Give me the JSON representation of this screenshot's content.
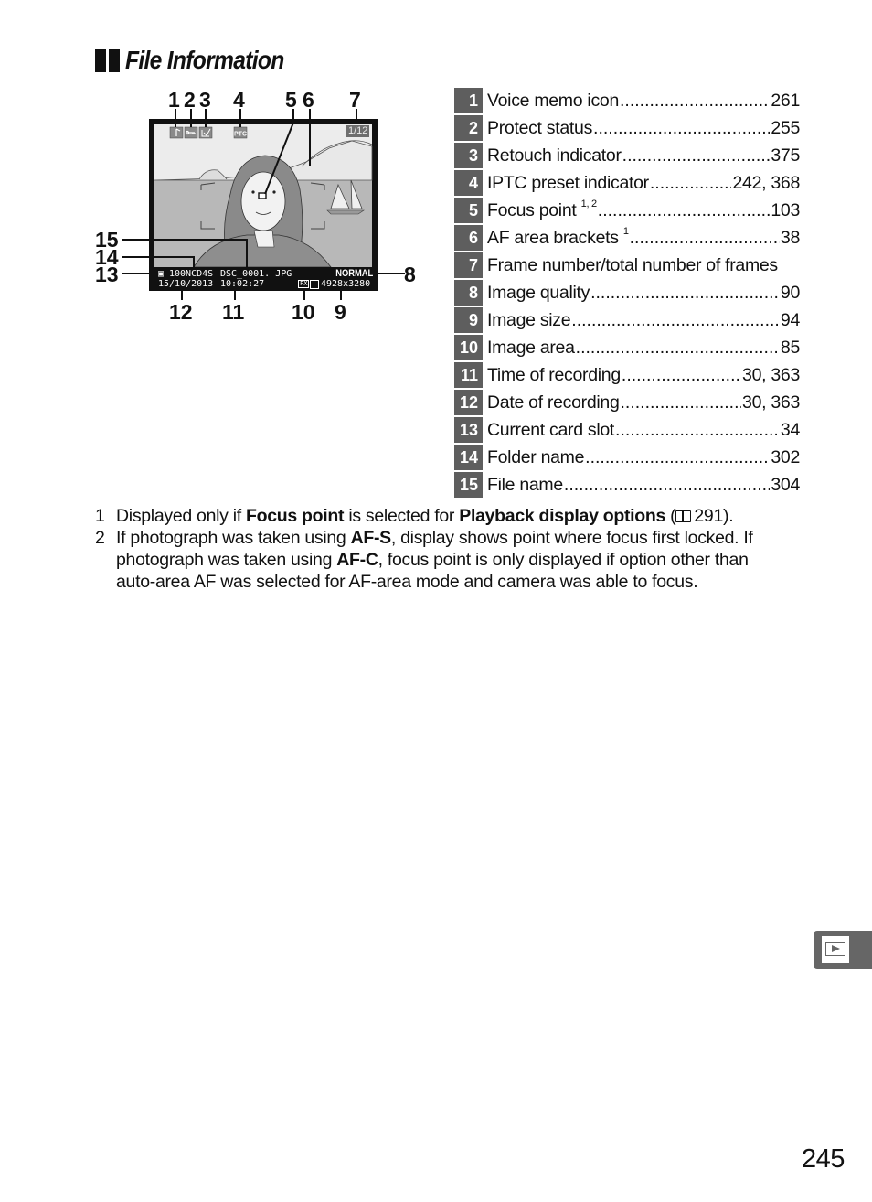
{
  "section": {
    "title": "File Information"
  },
  "illustration": {
    "callouts": [
      "1",
      "2",
      "3",
      "4",
      "5",
      "6",
      "7",
      "8",
      "9",
      "10",
      "11",
      "12",
      "13",
      "14",
      "15"
    ],
    "screen": {
      "frame_counter": "1/12",
      "iptc_label": "IPTC",
      "folder_name": "100NCD4S",
      "file_name": "DSC_0001. JPG",
      "image_quality": "NORMAL",
      "date": "15/10/2013",
      "time": "10:02:27",
      "image_area_badge": "FX",
      "image_size": "4928x3280",
      "icons": [
        "voice-memo-icon",
        "protect-key-icon",
        "retouch-icon",
        "iptc-icon",
        "card-slot-icon",
        "image-area-fx-icon",
        "image-size-large-icon"
      ]
    }
  },
  "references": [
    {
      "num": "1",
      "label": "Voice memo icon",
      "sup": "",
      "page": "261"
    },
    {
      "num": "2",
      "label": "Protect status",
      "sup": "",
      "page": "255"
    },
    {
      "num": "3",
      "label": "Retouch indicator",
      "sup": "",
      "page": "375"
    },
    {
      "num": "4",
      "label": "IPTC preset indicator",
      "sup": "",
      "page": "242, 368"
    },
    {
      "num": "5",
      "label": "Focus point",
      "sup": "1, 2",
      "page": "103"
    },
    {
      "num": "6",
      "label": "AF area brackets",
      "sup": "1",
      "page": "38"
    },
    {
      "num": "7",
      "label": "Frame number/total number of frames",
      "sup": "",
      "page": ""
    },
    {
      "num": "8",
      "label": "Image quality",
      "sup": "",
      "page": "90"
    },
    {
      "num": "9",
      "label": "Image size",
      "sup": "",
      "page": "94"
    },
    {
      "num": "10",
      "label": "Image area",
      "sup": "",
      "page": "85"
    },
    {
      "num": "11",
      "label": "Time of recording",
      "sup": "",
      "page": "30, 363"
    },
    {
      "num": "12",
      "label": "Date of recording",
      "sup": "",
      "page": "30, 363"
    },
    {
      "num": "13",
      "label": "Current card slot",
      "sup": "",
      "page": "34"
    },
    {
      "num": "14",
      "label": "Folder name",
      "sup": "",
      "page": "302"
    },
    {
      "num": "15",
      "label": "File name",
      "sup": "",
      "page": "304"
    }
  ],
  "footnotes": [
    {
      "num": "1",
      "parts": [
        {
          "t": "Displayed only if ",
          "b": false
        },
        {
          "t": "Focus point",
          "b": true
        },
        {
          "t": " is selected for ",
          "b": false
        },
        {
          "t": "Playback display options",
          "b": true
        },
        {
          "t": " (",
          "b": false
        },
        {
          "icon": "book-icon"
        },
        {
          "t": "291).",
          "b": false
        }
      ]
    },
    {
      "num": "2",
      "parts": [
        {
          "t": "If photograph was taken using ",
          "b": false
        },
        {
          "t": "AF-S",
          "b": true
        },
        {
          "t": ", display shows point where focus first locked.  If photograph was taken using ",
          "b": false
        },
        {
          "t": "AF-C",
          "b": true
        },
        {
          "t": ", focus point is only displayed if option other than auto-area AF was selected for AF-area mode and camera was able to focus.",
          "b": false
        }
      ]
    }
  ],
  "side_tab": {
    "icon": "playback-icon"
  },
  "page_number": "245",
  "colors": {
    "badge_bg": "#5e5e5e",
    "tab_bg": "#666666",
    "screen_frame": "#111111",
    "screen_bg": "#d9d9d9",
    "sea": "#b5b5b5"
  }
}
